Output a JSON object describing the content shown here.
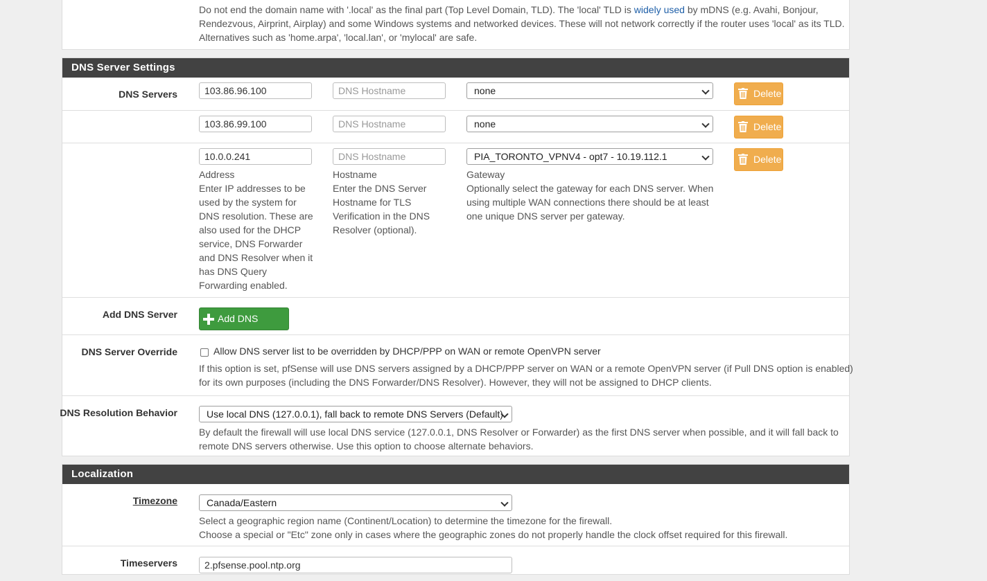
{
  "domain_note": {
    "text_before_link": "Do not end the domain name with '.local' as the final part (Top Level Domain, TLD). The 'local' TLD is ",
    "link": "widely used",
    "text_after_link_line1": " by mDNS (e.g. Avahi, Bonjour,",
    "line2": "Rendezvous, Airprint, Airplay) and some Windows systems and networked devices. These will not network correctly if the router uses 'local' as its TLD.",
    "line3": "Alternatives such as 'home.arpa', 'local.lan', or 'mylocal' are safe."
  },
  "dns_section": {
    "title": "DNS Server Settings",
    "dns_servers_label": "DNS Servers",
    "hostname_placeholder": "DNS Hostname",
    "delete_label": "Delete",
    "servers": [
      {
        "address": "103.86.96.100",
        "gateway": "none"
      },
      {
        "address": "103.86.99.100",
        "gateway": "none"
      },
      {
        "address": "10.0.0.241",
        "gateway": "PIA_TORONTO_VPNV4 - opt7 - 10.19.112.1"
      }
    ],
    "address_sub": "Address",
    "address_help": [
      "Enter IP addresses to be",
      "used by the system for",
      "DNS resolution. These are",
      "also used for the DHCP",
      "service, DNS Forwarder",
      "and DNS Resolver when it",
      "has DNS Query",
      "Forwarding enabled."
    ],
    "hostname_sub": "Hostname",
    "hostname_help": [
      "Enter the DNS Server",
      "Hostname for TLS",
      "Verification in the DNS",
      "Resolver (optional)."
    ],
    "gateway_sub": "Gateway",
    "gateway_help": [
      "Optionally select the gateway for each DNS server. When",
      "using multiple WAN connections there should be at least",
      "one unique DNS server per gateway."
    ],
    "add_label": "Add DNS Server",
    "add_button": "Add DNS Server",
    "override_label": "DNS Server Override",
    "override_checkbox": "Allow DNS server list to be overridden by DHCP/PPP on WAN or remote OpenVPN server",
    "override_help": [
      "If this option is set, pfSense will use DNS servers assigned by a DHCP/PPP server on WAN or a remote OpenVPN server (if Pull DNS option is enabled)",
      "for its own purposes (including the DNS Forwarder/DNS Resolver). However, they will not be assigned to DHCP clients."
    ],
    "resolution_label": "DNS Resolution Behavior",
    "resolution_value": "Use local DNS (127.0.0.1), fall back to remote DNS Servers (Default)",
    "resolution_help": [
      "By default the firewall will use local DNS service (127.0.0.1, DNS Resolver or Forwarder) as the first DNS server when possible, and it will fall back to",
      "remote DNS servers otherwise. Use this option to choose alternate behaviors."
    ]
  },
  "localization": {
    "title": "Localization",
    "timezone_label": "Timezone",
    "timezone_value": "Canada/Eastern",
    "timezone_help": [
      "Select a geographic region name (Continent/Location) to determine the timezone for the firewall.",
      "Choose a special or \"Etc\" zone only in cases where the geographic zones do not properly handle the clock offset required for this firewall."
    ],
    "timeservers_label": "Timeservers",
    "timeservers_value": "2.pfsense.pool.ntp.org"
  },
  "colors": {
    "header_bg": "#424242",
    "delete_btn": "#f0ad4e",
    "add_btn": "#3e9b3e",
    "link": "#1e5fa8"
  }
}
